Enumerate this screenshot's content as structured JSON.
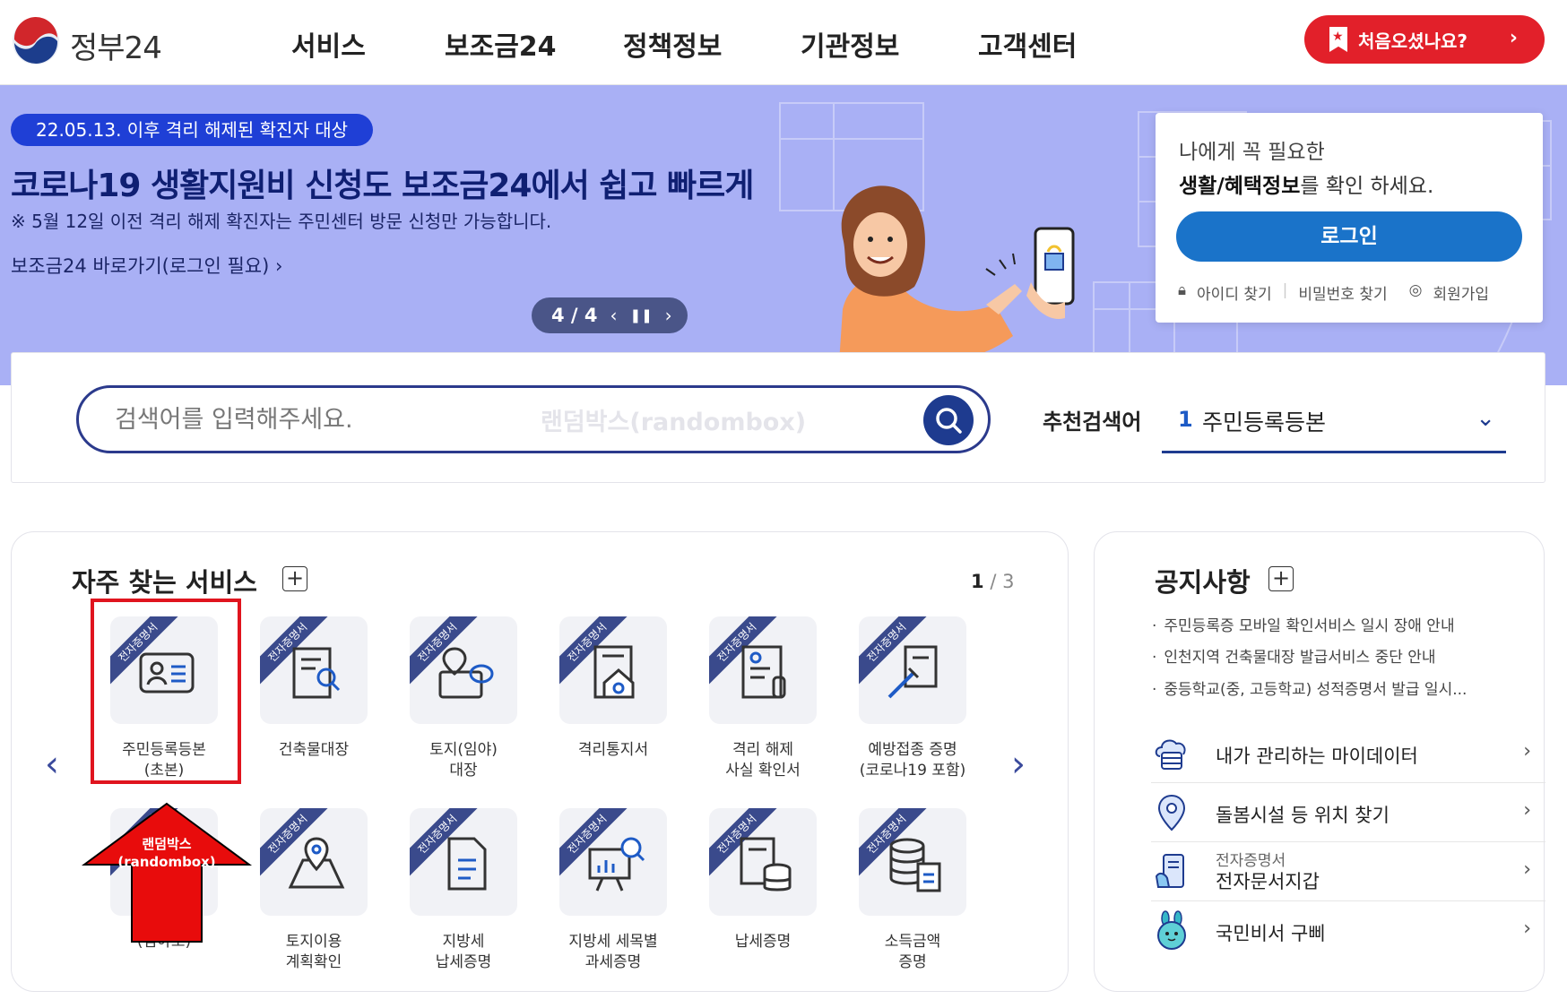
{
  "header": {
    "logo_text": "정부24",
    "nav": [
      "서비스",
      "보조금24",
      "정책정보",
      "기관정보",
      "고객센터"
    ],
    "first_visit_label": "처음오셨나요?"
  },
  "hero": {
    "pill": "22.05.13. 이후 격리 해제된 확진자 대상",
    "title": "코로나19 생활지원비 신청도 보조금24에서 쉽고 빠르게",
    "note": "※ 5월 12일 이전 격리 해제 확진자는 주민센터 방문 신청만 가능합니다.",
    "link": "보조금24 바로가기(로그인 필요) ›",
    "pager": "4 / 4"
  },
  "login": {
    "line1": "나에게 꼭 필요한",
    "line2_bold": "생활/혜택정보",
    "line2_rest": "를 확인 하세요.",
    "button": "로그인",
    "find_id": "아이디 찾기",
    "find_pw": "비밀번호 찾기",
    "join": "회원가입"
  },
  "search": {
    "placeholder": "검색어를 입력해주세요.",
    "watermark": "랜덤박스(randombox)",
    "recommend_label": "추천검색어",
    "recommend_num": "1",
    "recommend_text": "주민등록등본"
  },
  "services": {
    "title": "자주 찾는 서비스",
    "page_current": "1",
    "page_total": "/ 3",
    "badge": "전자증명서",
    "row1": [
      "주민등록등본\n(초본)",
      "건축물대장",
      "토지(임야)\n대장",
      "격리통지서",
      "격리 해제\n사실 확인서",
      "예방접종 증명\n(코로나19 포함)"
    ],
    "row2": [
      "(임야도)",
      "토지이용\n계획확인",
      "지방세\n납세증명",
      "지방세 세목별\n과세증명",
      "납세증명",
      "소득금액\n증명"
    ]
  },
  "annotation": {
    "arrow_label_1": "랜덤박스",
    "arrow_label_2": "(randombox)"
  },
  "notice": {
    "title": "공지사항",
    "items": [
      "주민등록증 모바일 확인서비스 일시 장애 안내",
      "인천지역 건축물대장 발급서비스 중단 안내",
      "중등학교(중, 고등학교) 성적증명서 발급 일시..."
    ],
    "links": [
      {
        "label": "내가 관리하는 마이데이터"
      },
      {
        "label": "돌봄시설 등 위치 찾기"
      },
      {
        "sub": "전자증명서",
        "label": "전자문서지갑"
      },
      {
        "label": "국민비서 구삐"
      }
    ]
  },
  "colors": {
    "hero_bg": "#a9b0f5",
    "brand_navy": "#1e3b8f",
    "first_btn": "#e2202a",
    "login_btn": "#1a73c9",
    "highlight": "#e0141e"
  }
}
